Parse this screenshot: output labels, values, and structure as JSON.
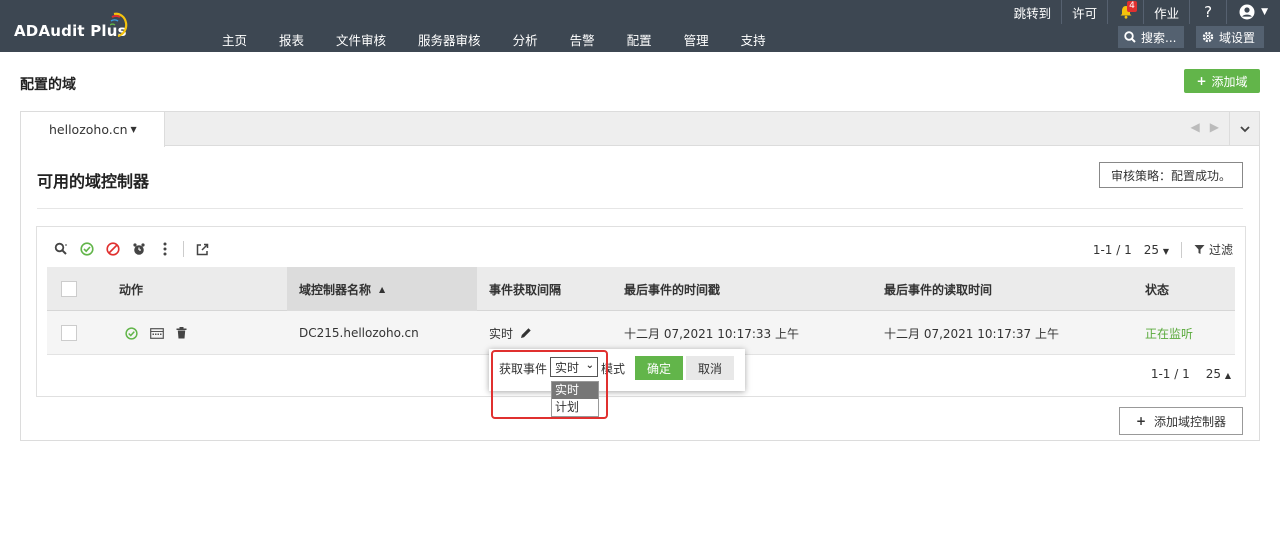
{
  "header": {
    "logo_text": "ADAudit Plus",
    "nav": [
      "主页",
      "报表",
      "文件审核",
      "服务器审核",
      "分析",
      "告警",
      "配置",
      "管理",
      "支持"
    ],
    "jump_to": "跳转到",
    "license": "许可",
    "notification_count": "4",
    "jobs": "作业",
    "help": "?",
    "search_label": "搜索...",
    "domain_settings_label": "域设置"
  },
  "page": {
    "title": "配置的域",
    "add_domain_label": "添加域"
  },
  "domain_tab": {
    "name": "hellozoho.cn"
  },
  "section": {
    "title": "可用的域控制器",
    "policy_label": "审核策略：配置成功。"
  },
  "grid": {
    "paging_top": "1-1 / 1",
    "page_size_top": "25",
    "filter_label": "过滤",
    "columns": {
      "action": "动作",
      "dc_name": "域控制器名称",
      "interval": "事件获取间隔",
      "last_event_time": "最后事件的时间戳",
      "last_read_time": "最后事件的读取时间",
      "status": "状态"
    },
    "rows": [
      {
        "dc_name": "DC215.hellozoho.cn",
        "interval": "实时",
        "last_event_time": "十二月 07,2021 10:17:33 上午",
        "last_read_time": "十二月 07,2021 10:17:37 上午",
        "status": "正在监听"
      }
    ],
    "paging_bottom": "1-1 / 1",
    "page_size_bottom": "25"
  },
  "add_dc_label": "添加域控制器",
  "popup": {
    "label": "获取事件",
    "selected": "实时",
    "mode_label": "模式",
    "ok_label": "确定",
    "cancel_label": "取消",
    "options": [
      "实时",
      "计划"
    ]
  },
  "colors": {
    "header_bg": "#3d4752",
    "accent_green": "#62b54a",
    "status_green": "#5aaa3c",
    "highlight_red": "#e0302f"
  }
}
